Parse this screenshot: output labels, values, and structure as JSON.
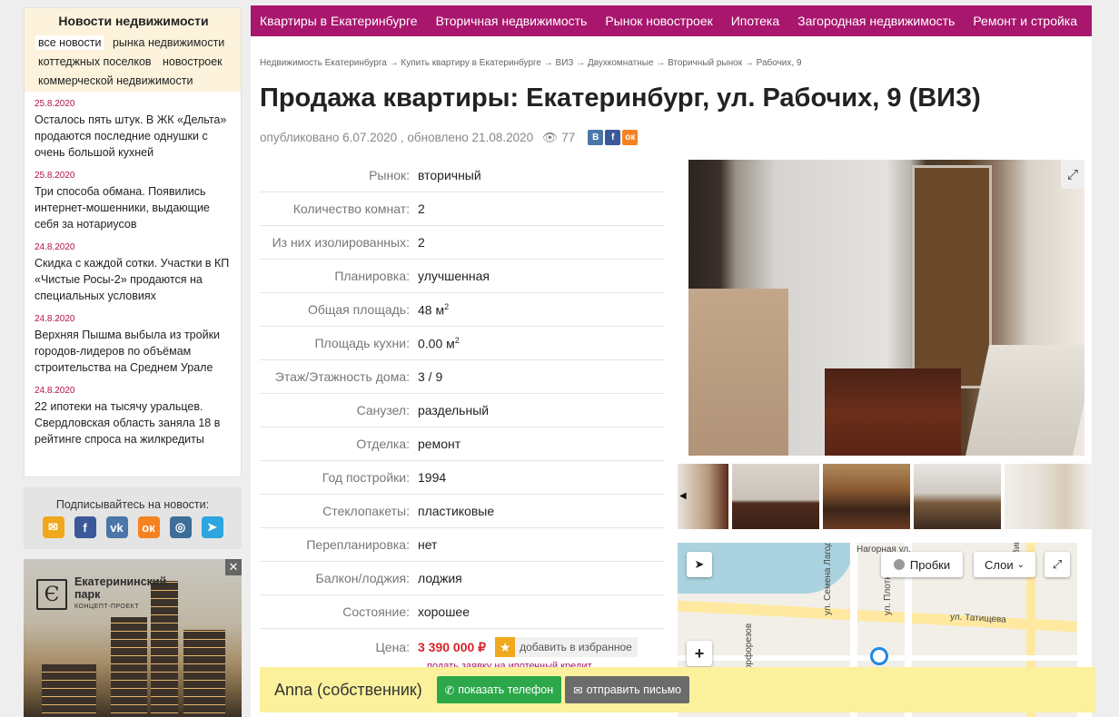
{
  "sidebar": {
    "news_title": "Новости недвижимости",
    "news_tags": [
      "все новости",
      "рынка недвижимости",
      "коттеджных поселков",
      "новостроек",
      "коммерческой недвижимости"
    ],
    "news": [
      {
        "date": "25.8.2020",
        "text": "Осталось пять штук. В ЖК «Дельта» продаются последние однушки с очень большой кухней"
      },
      {
        "date": "25.8.2020",
        "text": "Три способа обмана. Появились интернет-мошенники, выдающие себя за нотариусов"
      },
      {
        "date": "24.8.2020",
        "text": "Скидка с каждой сотки. Участки в КП «Чистые Росы-2» продаются на специальных условиях"
      },
      {
        "date": "24.8.2020",
        "text": "Верхняя Пышма выбыла из тройки городов-лидеров по объёмам строительства на Среднем Урале"
      },
      {
        "date": "24.8.2020",
        "text": "22 ипотеки на тысячу уральцев. Свердловская область заняла 18 в рейтинге спроса на жилкредиты"
      }
    ],
    "subscribe_title": "Подписывайтесь на новости:",
    "socials": [
      {
        "icon": "email-icon",
        "glyph": "✉",
        "color": "#f0a81c"
      },
      {
        "icon": "facebook-icon",
        "glyph": "f",
        "color": "#3b5998"
      },
      {
        "icon": "vk-icon",
        "glyph": "vk",
        "color": "#4a76a8"
      },
      {
        "icon": "odnoklassniki-icon",
        "glyph": "ок",
        "color": "#f58220"
      },
      {
        "icon": "instagram-icon",
        "glyph": "◎",
        "color": "#3d6d99"
      },
      {
        "icon": "telegram-icon",
        "glyph": "➤",
        "color": "#2ca5e0"
      }
    ],
    "ad": {
      "logo_glyph": "Є",
      "title_line1": "Екатерининский",
      "title_line2": "парк",
      "subtitle": "КОНЦЕПТ-ПРОЕКТ",
      "close": "✕"
    }
  },
  "topnav": [
    "Квартиры в Екатеринбурге",
    "Вторичная недвижимость",
    "Рынок новостроек",
    "Ипотека",
    "Загородная недвижимость",
    "Ремонт и стройка"
  ],
  "breadcrumb": "Недвижимость Екатеринбурга → Купить квартиру в Екатеринбурге → ВИЗ → Двухкомнатные → Вторичный рынок → Рабочих, 9",
  "listing": {
    "title": "Продажа квартиры: Екатеринбург, ул. Рабочих, 9 (ВИЗ)",
    "published": "опубликовано 6.07.2020 , обновлено 21.08.2020",
    "views": "77",
    "share": [
      {
        "icon": "vk-share-icon",
        "glyph": "В",
        "color": "#4a76a8"
      },
      {
        "icon": "facebook-share-icon",
        "glyph": "f",
        "color": "#3b5998"
      },
      {
        "icon": "ok-share-icon",
        "glyph": "ок",
        "color": "#f58220"
      }
    ],
    "props": [
      {
        "label": "Рынок:",
        "value": "вторичный"
      },
      {
        "label": "Количество комнат:",
        "value": "2"
      },
      {
        "label": "Из них изолированных:",
        "value": "2"
      },
      {
        "label": "Планировка:",
        "value": "улучшенная"
      },
      {
        "label": "Общая площадь:",
        "value": "48 м",
        "sup": "2"
      },
      {
        "label": "Площадь кухни:",
        "value": "0.00 м",
        "sup": "2"
      },
      {
        "label": "Этаж/Этажность дома:",
        "value": "3 / 9"
      },
      {
        "label": "Санузел:",
        "value": "раздельный"
      },
      {
        "label": "Отделка:",
        "value": "ремонт"
      },
      {
        "label": "Год постройки:",
        "value": "1994"
      },
      {
        "label": "Стеклопакеты:",
        "value": "пластиковые"
      },
      {
        "label": "Перепланировка:",
        "value": "нет"
      },
      {
        "label": "Балкон/лоджия:",
        "value": "лоджия"
      },
      {
        "label": "Состояние:",
        "value": "хорошее"
      }
    ],
    "price_label": "Цена:",
    "price": "3 390 000 ₽",
    "favorite": "добавить в избранное",
    "mortgage_link": "подать заявку на ипотечный кредит"
  },
  "map": {
    "traffic": "Пробки",
    "layers": "Слои",
    "streets": [
      "Нагорная ул.",
      "ул. Татищева",
      "ул. Семена Лагоды",
      "ул. Плотников",
      "ул. Вику",
      "орфорезов"
    ]
  },
  "contact": {
    "name": "Anna (собственник)",
    "phone_button": "показать телефон",
    "mail_button": "отправить письмо"
  }
}
